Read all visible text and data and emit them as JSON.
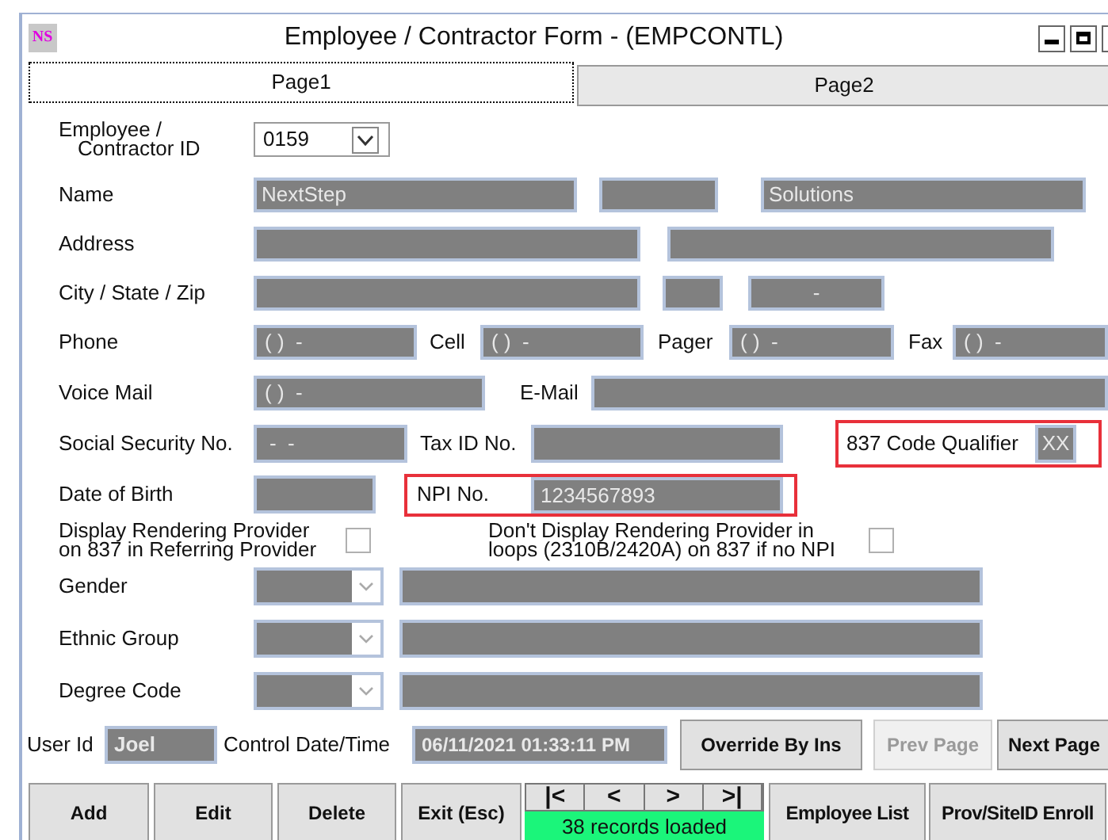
{
  "window": {
    "title": "Employee / Contractor Form - (EMPCONTL)",
    "icon_text": "NS"
  },
  "tabs": [
    {
      "label": "Page1",
      "selected": true
    },
    {
      "label": "Page2",
      "selected": false
    }
  ],
  "employee_id": {
    "label_lines": [
      "Employee /",
      "Contractor ID"
    ],
    "value": "0159"
  },
  "name": {
    "label": "Name",
    "first": "NextStep",
    "last": "Solutions"
  },
  "address": {
    "label": "Address"
  },
  "city_state_zip": {
    "label": "City / State / Zip",
    "zip": "-"
  },
  "phone": {
    "label": "Phone",
    "value": "( )  -"
  },
  "cell": {
    "label": "Cell",
    "value": "( )  -"
  },
  "pager": {
    "label": "Pager",
    "value": "( )  -"
  },
  "fax": {
    "label": "Fax",
    "value": "( )  -"
  },
  "voice_mail": {
    "label": "Voice Mail",
    "value": "( )  -"
  },
  "email": {
    "label": "E-Mail"
  },
  "ssn": {
    "label": "Social Security No.",
    "value": "-  -"
  },
  "tax_id": {
    "label": "Tax ID No."
  },
  "code_qualifier": {
    "label": "837 Code Qualifier",
    "value": "XX",
    "highlighted": true
  },
  "dob": {
    "label": "Date of Birth"
  },
  "npi": {
    "label": "NPI No.",
    "value": "1234567893",
    "highlighted": true
  },
  "checkboxes": [
    {
      "label_lines": [
        "Display Rendering Provider",
        "on 837 in Referring Provider"
      ],
      "checked": false
    },
    {
      "label_lines": [
        "Don't Display Rendering Provider in",
        "loops (2310B/2420A) on 837 if no NPI"
      ],
      "checked": false
    }
  ],
  "dropdowns": [
    {
      "label": "Gender"
    },
    {
      "label": "Ethnic Group"
    },
    {
      "label": "Degree Code"
    }
  ],
  "user_id": {
    "label": "User Id",
    "value": "Joel"
  },
  "control_datetime": {
    "label": "Control Date/Time",
    "value": "06/11/2021 01:33:11 PM"
  },
  "page_buttons": [
    {
      "label": "Override By Ins",
      "disabled": false
    },
    {
      "label": "Prev Page",
      "disabled": true
    },
    {
      "label": "Next Page",
      "disabled": false
    }
  ],
  "buttons": [
    {
      "label": "Add"
    },
    {
      "label": "Edit"
    },
    {
      "label": "Delete"
    },
    {
      "label": "Exit (Esc)"
    }
  ],
  "navigator": {
    "buttons": [
      "|<",
      "<",
      ">",
      ">|"
    ],
    "status": "38 records loaded"
  },
  "buttons_right": [
    {
      "label": "Employee List"
    },
    {
      "label": "Prov/SiteID Enroll"
    }
  ]
}
